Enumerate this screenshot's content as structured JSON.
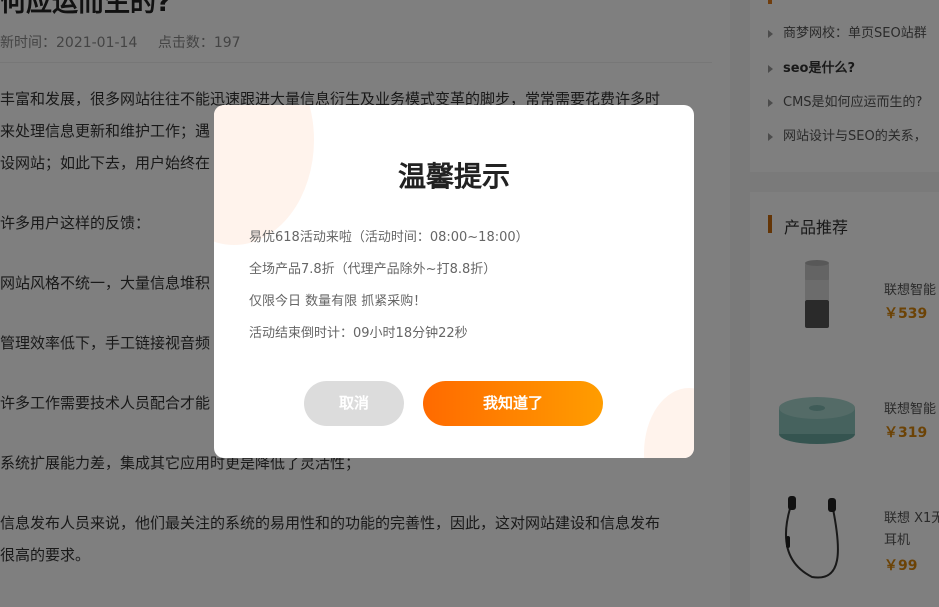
{
  "article": {
    "title": "何应运而生的?",
    "update_time": "新时间：2021-01-14",
    "clicks": "点击数：197",
    "paragraphs": [
      "丰富和发展，很多网站往往不能迅速跟进大量信息衍生及业务模式变革的脚步，常常需要花费许多时",
      "来处理信息更新和维护工作；遇",
      "设网站；如此下去，用户始终在",
      "许多用户这样的反馈：",
      "网站风格不统一，大量信息堆积",
      "管理效率低下，手工链接视音频",
      "许多工作需要技术人员配合才能",
      "系统扩展能力差，集成其它应用时更是降低了灵活性；",
      "信息发布人员来说，他们最关注的系统的易用性和的功能的完善性，因此，这对网站建设和信息发布",
      "很高的要求。"
    ]
  },
  "sidebar": {
    "links": [
      "商梦网校：单页SEO站群",
      "seo是什么?",
      "CMS是如何应运而生的?",
      "网站设计与SEO的关系，"
    ],
    "product_heading": "产品推荐",
    "products": [
      {
        "name": "联想智能",
        "price": "￥539"
      },
      {
        "name": "联想智能",
        "price": "￥319"
      },
      {
        "name": "联想 X1无",
        "name2": "耳机",
        "price": "￥99"
      }
    ]
  },
  "modal": {
    "title": "温馨提示",
    "lines": [
      "易优618活动来啦（活动时间：08:00~18:00）",
      "全场产品7.8折（代理产品除外~打8.8折）",
      "仅限今日 数量有限 抓紧采购！",
      "活动结束倒时计：09小时18分钟22秒"
    ],
    "cancel_label": "取消",
    "ok_label": "我知道了"
  },
  "colors": {
    "accent_start": "#ff6a00",
    "accent_end": "#ff9d00",
    "price": "#d9860c"
  }
}
